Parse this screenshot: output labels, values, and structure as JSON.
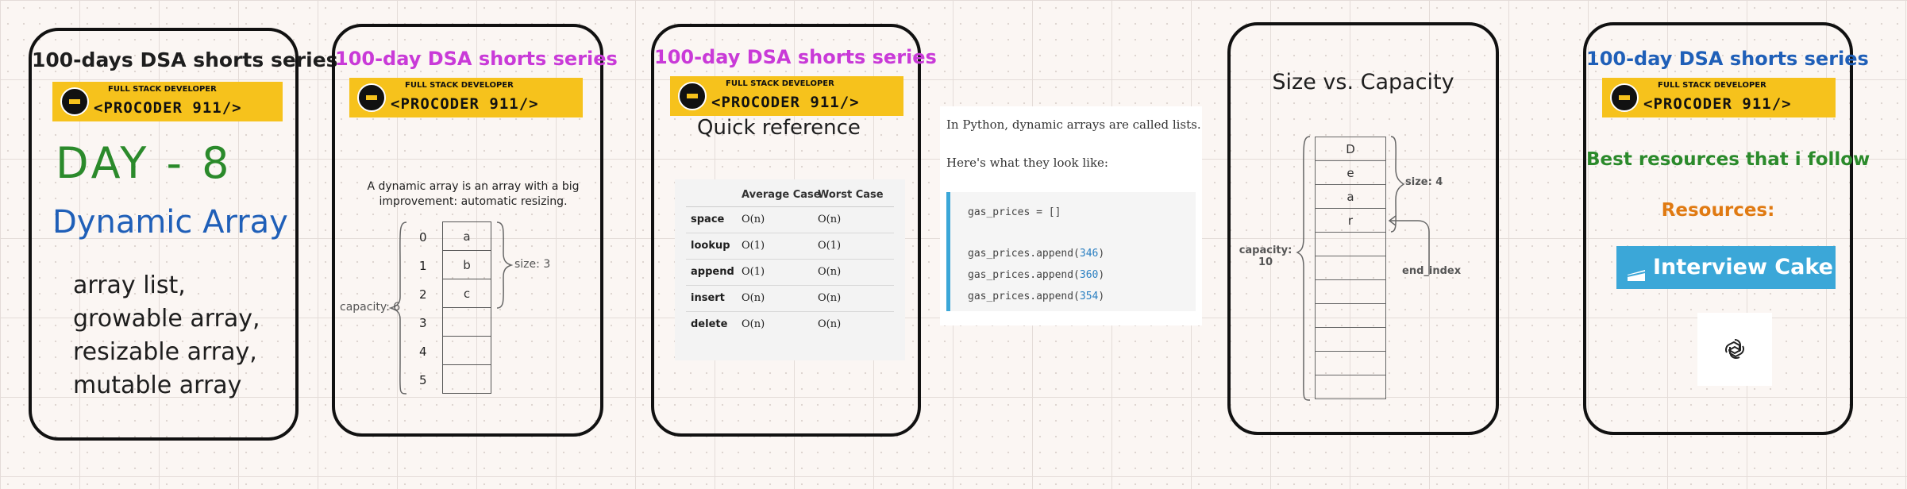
{
  "colors": {
    "purple": "#c93ad8",
    "blue": "#1f5fb8",
    "green": "#2b8a2b",
    "orange": "#e07a12",
    "teal": "#3ba7d8",
    "code_blue": "#2a7fc1"
  },
  "banner": {
    "text": "<PROCODER 911/>",
    "top_text": "FULL STACK DEVELOPER",
    "icons": [
      "instagram-icon",
      "camera-icon",
      "telegram-icon",
      "discord-icon",
      "c-logo-icon"
    ]
  },
  "card1": {
    "title": "100-days DSA shorts series",
    "day": "DAY - 8",
    "topic": "Dynamic Array",
    "aliases": [
      "array list,",
      "growable array,",
      "resizable array,",
      "mutable array"
    ]
  },
  "card2": {
    "title": "100-day DSA shorts series",
    "description": "A dynamic array is an array with a big improvement: automatic resizing.",
    "indices": [
      "0",
      "1",
      "2",
      "3",
      "4",
      "5"
    ],
    "values": [
      "a",
      "b",
      "c",
      "",
      "",
      ""
    ],
    "size_label": "size: 3",
    "capacity_label": "capacity: 6"
  },
  "card3": {
    "title": "100-day DSA shorts series",
    "subtitle": "Quick reference",
    "table": {
      "headers": [
        "",
        "Average Case",
        "Worst Case"
      ],
      "rows": [
        [
          "space",
          "O(n)",
          "O(n)"
        ],
        [
          "lookup",
          "O(1)",
          "O(1)"
        ],
        [
          "append",
          "O(1)",
          "O(n)"
        ],
        [
          "insert",
          "O(n)",
          "O(n)"
        ],
        [
          "delete",
          "O(n)",
          "O(n)"
        ]
      ]
    }
  },
  "python_panel": {
    "intro": "In Python, dynamic arrays are called lists.",
    "lead": "Here's what they look like:",
    "code": [
      {
        "text": "gas_prices = []",
        "value": ""
      },
      {
        "text": "",
        "value": ""
      },
      {
        "text": "gas_prices.append(",
        "value": "346"
      },
      {
        "text": "gas_prices.append(",
        "value": "360"
      },
      {
        "text": "gas_prices.append(",
        "value": "354"
      }
    ]
  },
  "card4": {
    "title": "Size vs. Capacity",
    "cells": [
      "D",
      "e",
      "a",
      "r",
      "",
      "",
      "",
      "",
      "",
      "",
      ""
    ],
    "size_label": "size: 4",
    "capacity_label": "capacity:",
    "capacity_value": "10",
    "end_label": "end_index"
  },
  "card5": {
    "title": "100-day DSA shorts series",
    "heading": "Best resources that i follow",
    "resources_label": "Resources:",
    "interview_cake": "Interview Cake",
    "chatgpt_icon": "openai-icon"
  }
}
